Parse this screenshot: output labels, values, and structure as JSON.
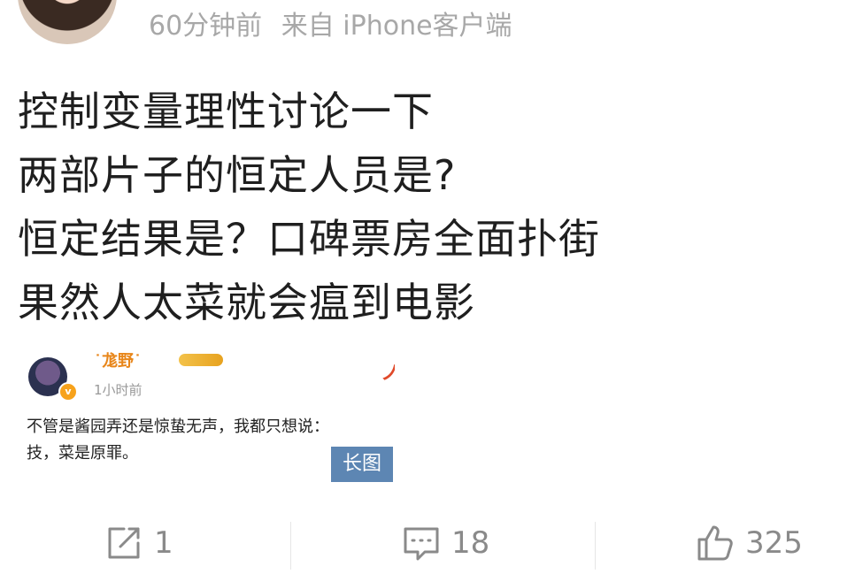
{
  "header": {
    "time": "60分钟前",
    "source": "来自 iPhone客户端"
  },
  "post": {
    "lines": [
      "控制变量理性讨论一下",
      "两部片子的恒定人员是?",
      "恒定结果是？口碑票房全面扑街",
      "果然人太菜就会瘟到电影"
    ]
  },
  "embedded_card": {
    "username": "˙尨野˙",
    "time": "1小时前",
    "body_lines": [
      "不管是酱园弄还是惊蛰无声，我都只想说：",
      "技，菜是原罪。"
    ],
    "long_image_label": "长图"
  },
  "actions": {
    "repost_count": "1",
    "comment_count": "18",
    "like_count": "325"
  },
  "icons": {
    "repost": "repost-icon",
    "comment": "comment-icon",
    "like": "thumbs-up-icon",
    "verified": "verified-badge-icon"
  },
  "colors": {
    "meta_text": "#a8a8a8",
    "action_gray": "#8a8a8a",
    "long_image_badge": "#5d86b3",
    "verified_badge": "#f7a21b"
  }
}
